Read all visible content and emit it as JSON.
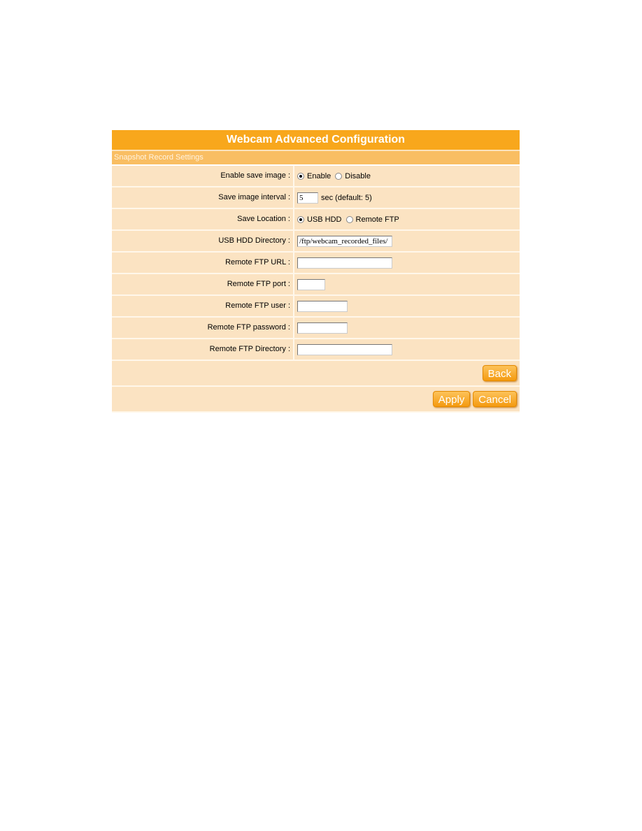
{
  "header": {
    "title": "Webcam Advanced Configuration"
  },
  "section": {
    "title": "Snapshot Record Settings"
  },
  "rows": {
    "enable_save": {
      "label": "Enable save image :",
      "options": [
        "Enable",
        "Disable"
      ],
      "selected": "Enable"
    },
    "interval": {
      "label": "Save image interval :",
      "value": "5",
      "suffix": "sec (default: 5)"
    },
    "location": {
      "label": "Save Location :",
      "options": [
        "USB HDD",
        "Remote FTP"
      ],
      "selected": "USB HDD"
    },
    "usb_dir": {
      "label": "USB HDD Directory :",
      "value": "/ftp/webcam_recorded_files/"
    },
    "ftp_url": {
      "label": "Remote FTP URL :",
      "value": ""
    },
    "ftp_port": {
      "label": "Remote FTP port :",
      "value": ""
    },
    "ftp_user": {
      "label": "Remote FTP user :",
      "value": ""
    },
    "ftp_password": {
      "label": "Remote FTP password :",
      "value": ""
    },
    "ftp_dir": {
      "label": "Remote FTP Directory :",
      "value": ""
    }
  },
  "buttons": {
    "back": "Back",
    "apply": "Apply",
    "cancel": "Cancel"
  }
}
